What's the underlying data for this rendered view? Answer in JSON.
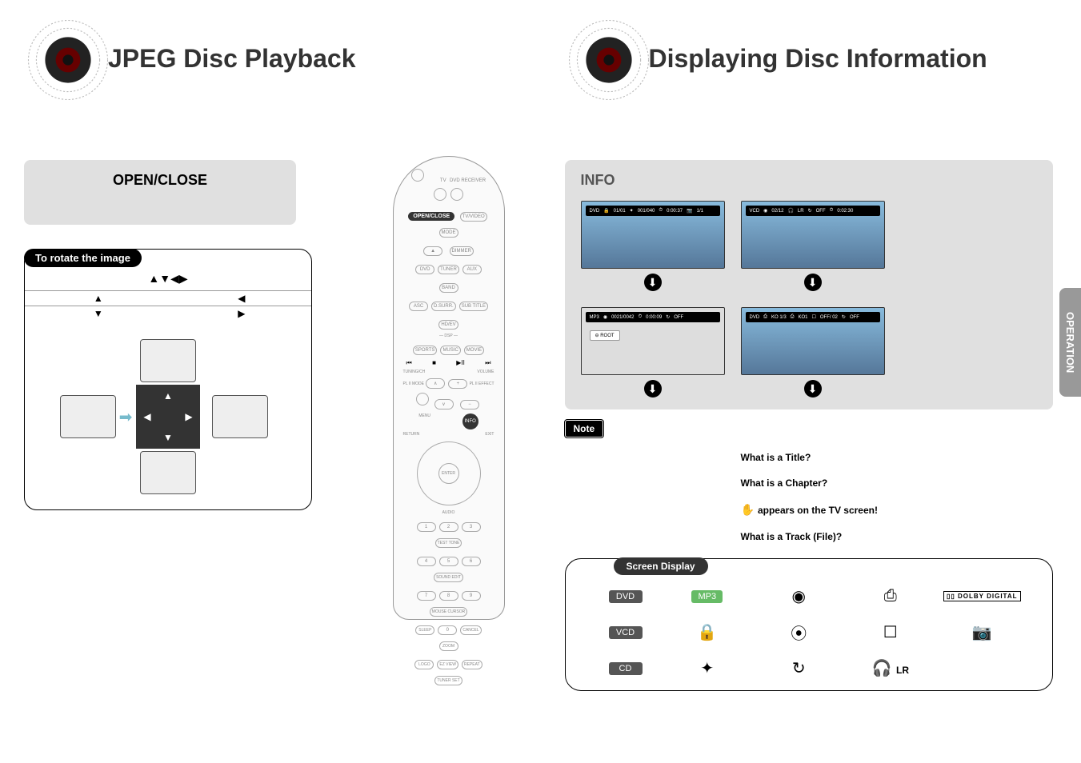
{
  "left": {
    "title": "JPEG Disc Playback",
    "openclose_label": "OPEN/CLOSE",
    "rotate_header": "To rotate the image",
    "rotate_arrows": "▲▼◀▶",
    "rotate_cells": {
      "up": "▲",
      "left": "◀",
      "down": "▼",
      "right": "▶"
    }
  },
  "right": {
    "title": "Displaying Disc Information",
    "info_label": "INFO",
    "note_label": "Note",
    "faq": {
      "title": "What is a Title?",
      "chapter": "What is a Chapter?",
      "tv_hint": "appears on the TV screen!",
      "track": "What is a Track (File)?"
    },
    "screen_display_header": "Screen Display",
    "screens": {
      "s1": {
        "tag": "DVD",
        "t": "01/01",
        "ch": "001/040",
        "time": "0:00:37",
        "ang": "1/1"
      },
      "s2": {
        "tag": "VCD",
        "tr": "02/12",
        "aud": "LR",
        "rep": "OFF",
        "time": "0:02:30"
      },
      "s3": {
        "tag": "MP3",
        "tr": "0021/0042",
        "time": "0:00:09",
        "rep": "OFF",
        "root": "ROOT"
      },
      "s4": {
        "tag": "DVD",
        "k": "KO 1/3",
        "sub": "KO1",
        "rep": "OFF/ 02",
        "rep2": "OFF"
      }
    },
    "grid": {
      "row1": {
        "tag": "DVD",
        "c1": "MP3",
        "i1": "◉",
        "i2": "title-chapter-icon",
        "i3": "DOLBY DIGITAL"
      },
      "row2": {
        "tag": "VCD",
        "i0": "title-lock-icon",
        "i1": "⦿",
        "i2": "subtitle-icon",
        "i3": "angle-icon"
      },
      "row3": {
        "tag": "CD",
        "i0": "stereo-icon",
        "i1": "↻",
        "i2": "audio-lr-icon",
        "lr": "LR"
      }
    }
  },
  "remote": {
    "openclose": "OPEN/CLOSE",
    "tvvideo": "TV/VIDEO",
    "mode": "MODE",
    "dimmer": "DIMMER",
    "tv": "TV",
    "dvdrecv": "DVD RECEIVER",
    "dvd": "DVD",
    "tuner": "TUNER",
    "aux": "AUX",
    "band": "BAND",
    "asc": "ASC",
    "dsurr": "D.SURR.",
    "subtitle": "SUB TITLE",
    "hdev": "HD/EV",
    "sports": "SPORTS",
    "music": "MUSIC",
    "movie": "MOVIE",
    "dsp": "DSP",
    "tuning": "TUNING/CH",
    "volume": "VOLUME",
    "pl2mode": "PL II MODE",
    "pl2effect": "PL II EFFECT",
    "menu": "MENU",
    "info": "INFO",
    "enter": "ENTER",
    "return": "RETURN",
    "exit": "EXIT",
    "audio": "AUDIO",
    "testtone": "TEST TONE",
    "soundedit": "SOUND EDIT",
    "mousecurs": "MOUSE CURSOR",
    "sleep": "SLEEP",
    "cancel": "CANCEL",
    "zoom": "ZOOM",
    "logo": "LOGO",
    "ezview": "EZ VIEW",
    "repeat": "REPEAT",
    "tunerset": "TUNER SET"
  },
  "tab": "OPERATION"
}
